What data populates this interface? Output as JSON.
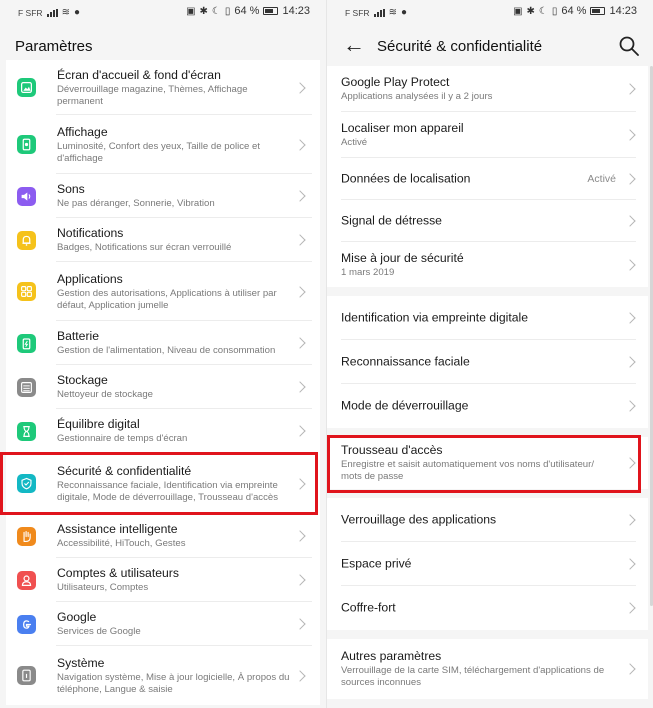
{
  "status_bar": {
    "carrier": "F SFR",
    "battery": "64 %",
    "time": "14:23"
  },
  "left_panel": {
    "title": "Paramètres",
    "items": [
      {
        "title": "Écran d'accueil & fond d'écran",
        "subtitle": "Déverrouillage magazine, Thèmes, Affichage permanent",
        "icon": "image-icon",
        "color": "#1ec97a"
      },
      {
        "title": "Affichage",
        "subtitle": "Luminosité, Confort des yeux, Taille de police et d'affichage",
        "icon": "phone-brightness-icon",
        "color": "#1ec97a"
      },
      {
        "title": "Sons",
        "subtitle": "Ne pas déranger, Sonnerie, Vibration",
        "icon": "speaker-icon",
        "color": "#8c5cf0"
      },
      {
        "title": "Notifications",
        "subtitle": "Badges, Notifications sur écran verrouillé",
        "icon": "bell-icon",
        "color": "#f5c21b"
      },
      {
        "title": "Applications",
        "subtitle": "Gestion des autorisations, Applications à utiliser par défaut, Application jumelle",
        "icon": "grid-icon",
        "color": "#f5c21b"
      },
      {
        "title": "Batterie",
        "subtitle": "Gestion de l'alimentation, Niveau de consommation",
        "icon": "battery-icon",
        "color": "#1ec97a"
      },
      {
        "title": "Stockage",
        "subtitle": "Nettoyeur de stockage",
        "icon": "storage-icon",
        "color": "#8a8a8a"
      },
      {
        "title": "Équilibre digital",
        "subtitle": "Gestionnaire de temps d'écran",
        "icon": "hourglass-icon",
        "color": "#1ec97a"
      },
      {
        "title": "Sécurité & confidentialité",
        "subtitle": "Reconnaissance faciale, Identification via empreinte digitale, Mode de déverrouillage, Trousseau d'accès",
        "icon": "shield-icon",
        "color": "#13b8c4"
      },
      {
        "title": "Assistance intelligente",
        "subtitle": "Accessibilité, HiTouch, Gestes",
        "icon": "hand-icon",
        "color": "#f08a1c"
      },
      {
        "title": "Comptes & utilisateurs",
        "subtitle": "Utilisateurs, Comptes",
        "icon": "user-icon",
        "color": "#f05050"
      },
      {
        "title": "Google",
        "subtitle": "Services de Google",
        "icon": "google-icon",
        "color": "#4a7ff0"
      },
      {
        "title": "Système",
        "subtitle": "Navigation système, Mise à jour logicielle, À propos du téléphone, Langue & saisie",
        "icon": "system-icon",
        "color": "#8a8a8a"
      }
    ]
  },
  "right_panel": {
    "title": "Sécurité & confidentialité",
    "groups": [
      [
        {
          "title": "Google Play Protect",
          "subtitle": "Applications analysées il y a 2 jours"
        },
        {
          "title": "Localiser mon appareil",
          "subtitle": "Activé"
        },
        {
          "title": "Données de localisation",
          "value": "Activé"
        },
        {
          "title": "Signal de détresse"
        },
        {
          "title": "Mise à jour de sécurité",
          "subtitle": "1 mars 2019"
        }
      ],
      [
        {
          "title": "Identification via empreinte digitale"
        },
        {
          "title": "Reconnaissance faciale"
        },
        {
          "title": "Mode de déverrouillage"
        }
      ],
      [
        {
          "title": "Trousseau d'accès",
          "subtitle": "Enregistre et saisit automatiquement vos noms d'utilisateur/ mots de passe"
        }
      ],
      [
        {
          "title": "Verrouillage des applications"
        },
        {
          "title": "Espace privé"
        },
        {
          "title": "Coffre-fort"
        }
      ],
      [
        {
          "title": "Autres paramètres",
          "subtitle": "Verrouillage de la carte SIM, téléchargement d'applications de sources inconnues"
        }
      ]
    ]
  },
  "highlight_color": "#e0141c"
}
